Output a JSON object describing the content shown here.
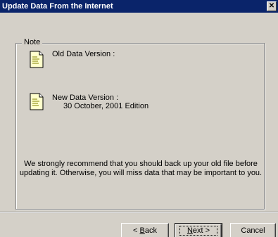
{
  "window": {
    "title": "Update Data From the Internet",
    "close_glyph": "✕"
  },
  "note": {
    "legend": "Note",
    "old_label": "Old Data Version :",
    "new_label": "New Data Version :",
    "new_value": "30 October, 2001 Edition",
    "recommend_line1": "We strongly recommend that you should back up your old file before",
    "recommend_line2": "updating it. Otherwise, you will miss data that may be important to you."
  },
  "buttons": {
    "back_pre": "< ",
    "back_u": "B",
    "back_post": "ack",
    "next_u": "N",
    "next_post": "ext >",
    "cancel": "Cancel"
  },
  "icons": {
    "doc": "document-icon",
    "close": "close-icon"
  }
}
